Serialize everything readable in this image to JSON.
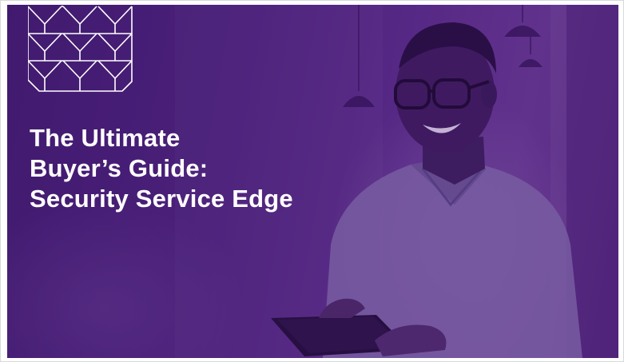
{
  "hero": {
    "headline": {
      "line1": "The Ultimate",
      "line2": "Buyer’s Guide:",
      "line3": "Security Service Edge"
    }
  },
  "colors": {
    "overlay_purple": "#4a2178",
    "text": "#ffffff"
  },
  "icons": {
    "logo": "geometric-y-lattice-logo",
    "lamps": "pendant-lamp"
  }
}
